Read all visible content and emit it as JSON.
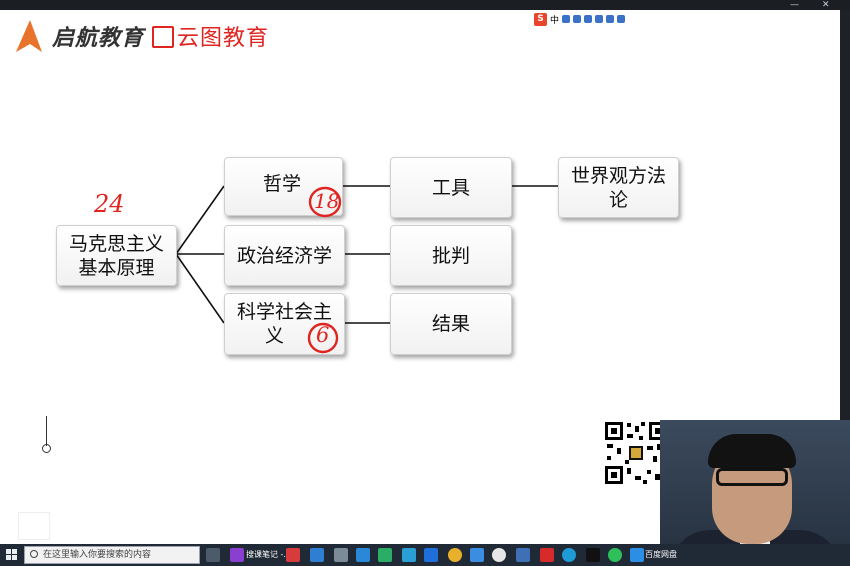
{
  "brand": {
    "primary": "启航教育",
    "secondary": "云图教育",
    "accent_color": "#e8732a",
    "secondary_color": "#e0241f"
  },
  "ime_toolbar": {
    "lang": "中"
  },
  "diagram": {
    "root": {
      "text_line1": "马克思主义",
      "text_line2": "基本原理"
    },
    "branches": [
      {
        "label": "哲学",
        "tool": "工具",
        "extra_line1": "世界观方法",
        "extra_line2": "论"
      },
      {
        "label": "政治经济学",
        "tool": "批判"
      },
      {
        "label_line1": "科学社会主",
        "label_line2": "义",
        "tool": "结果"
      }
    ],
    "annotations": {
      "root_note": "24",
      "philosophy_note": "18",
      "socialism_note": "6"
    }
  },
  "taskbar": {
    "search_placeholder": "在这里输入你要搜索的内容",
    "notes_app": "搜课笔记 -...",
    "cloud_app": "百度网盘"
  }
}
